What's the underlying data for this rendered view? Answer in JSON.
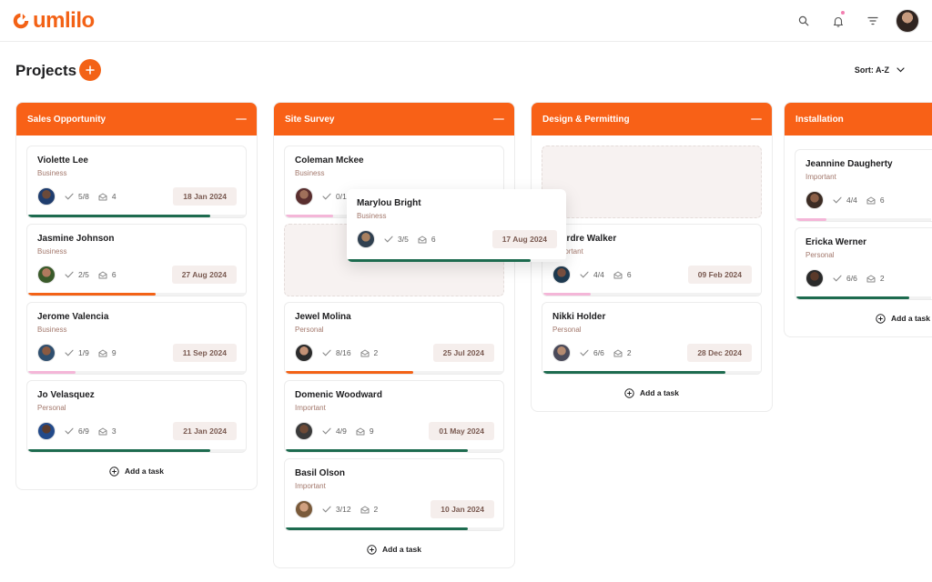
{
  "app": {
    "logo_text": "umlilo"
  },
  "header": {
    "icons": [
      "search-icon",
      "bell-icon",
      "filter-icon"
    ]
  },
  "page": {
    "title": "Projects",
    "sort_label": "Sort: A-Z"
  },
  "add_task_label": "Add a task",
  "colors": {
    "accent": "#f86117",
    "green": "#1d6b4f",
    "orange": "#f36216",
    "pink": "#f4b6d8"
  },
  "columns": [
    {
      "title": "Sales Opportunity",
      "cards": [
        {
          "name": "Violette Lee",
          "tag": "Business",
          "checks": "5/8",
          "messages": "4",
          "date": "18 Jan 2024",
          "progress": 0.84,
          "color": "green"
        },
        {
          "name": "Jasmine Johnson",
          "tag": "Business",
          "checks": "2/5",
          "messages": "6",
          "date": "27 Aug 2024",
          "progress": 0.59,
          "color": "orange"
        },
        {
          "name": "Jerome Valencia",
          "tag": "Business",
          "checks": "1/9",
          "messages": "9",
          "date": "11 Sep 2024",
          "progress": 0.22,
          "color": "pink"
        },
        {
          "name": "Jo Velasquez",
          "tag": "Personal",
          "checks": "6/9",
          "messages": "3",
          "date": "21 Jan 2024",
          "progress": 0.84,
          "color": "green"
        }
      ]
    },
    {
      "title": "Site Survey",
      "cards": [
        {
          "name": "Coleman Mckee",
          "tag": "Business",
          "checks": "0/1",
          "messages": "",
          "date": "",
          "progress": 0.22,
          "color": "pink"
        },
        {
          "name": "Jewel Molina",
          "tag": "Personal",
          "checks": "8/16",
          "messages": "2",
          "date": "25 Jul 2024",
          "progress": 0.59,
          "color": "orange"
        },
        {
          "name": "Domenic Woodward",
          "tag": "Important",
          "checks": "4/9",
          "messages": "9",
          "date": "01 May 2024",
          "progress": 0.84,
          "color": "green"
        },
        {
          "name": "Basil Olson",
          "tag": "Important",
          "checks": "3/12",
          "messages": "2",
          "date": "10 Jan 2024",
          "progress": 0.84,
          "color": "green"
        }
      ]
    },
    {
      "title": "Design & Permitting",
      "cards": [
        {
          "name": "Deirdre Walker",
          "tag": "Important",
          "checks": "4/4",
          "messages": "6",
          "date": "09 Feb 2024",
          "progress": 0.22,
          "color": "pink"
        },
        {
          "name": "Nikki Holder",
          "tag": "Personal",
          "checks": "6/6",
          "messages": "2",
          "date": "28 Dec 2024",
          "progress": 0.84,
          "color": "green"
        }
      ]
    },
    {
      "title": "Installation",
      "cards": [
        {
          "name": "Jeannine Daugherty",
          "tag": "Important",
          "checks": "4/4",
          "messages": "6",
          "date": "",
          "progress": 0.22,
          "color": "pink"
        },
        {
          "name": "Ericka Werner",
          "tag": "Personal",
          "checks": "6/6",
          "messages": "2",
          "date": "",
          "progress": 0.84,
          "color": "green"
        }
      ]
    }
  ],
  "dragging_card": {
    "name": "Marylou Bright",
    "tag": "Business",
    "checks": "3/5",
    "messages": "6",
    "date": "17 Aug 2024",
    "progress": 0.84,
    "color": "green"
  }
}
